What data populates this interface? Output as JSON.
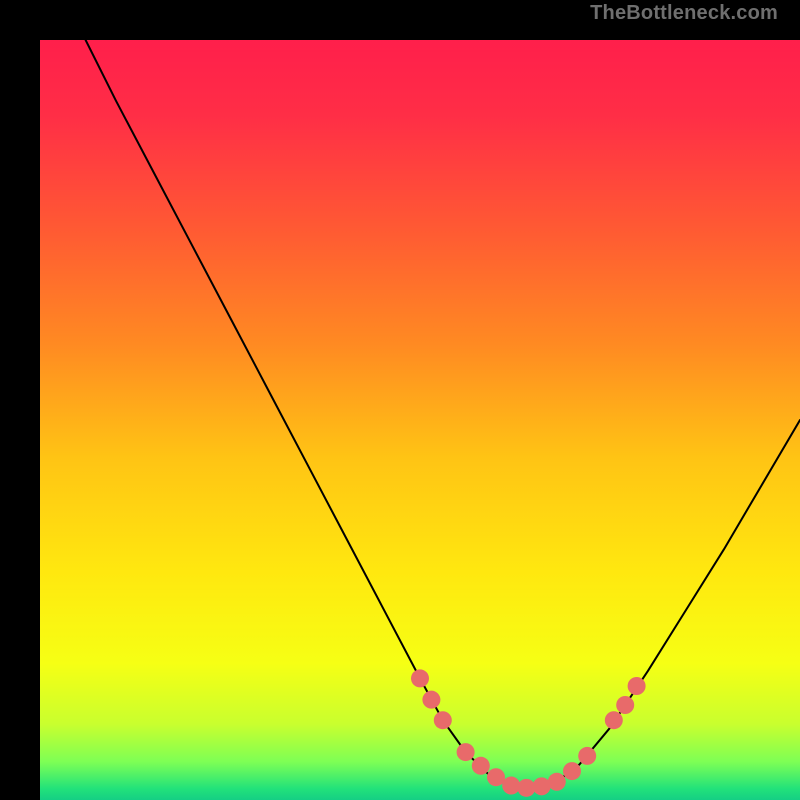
{
  "watermark": "TheBottleneck.com",
  "gradient_stops": [
    {
      "pos": 0.0,
      "color": "#ff1f4b"
    },
    {
      "pos": 0.1,
      "color": "#ff2e46"
    },
    {
      "pos": 0.25,
      "color": "#ff5a33"
    },
    {
      "pos": 0.4,
      "color": "#ff8a22"
    },
    {
      "pos": 0.55,
      "color": "#ffc414"
    },
    {
      "pos": 0.7,
      "color": "#ffe80f"
    },
    {
      "pos": 0.82,
      "color": "#f6ff14"
    },
    {
      "pos": 0.9,
      "color": "#c9ff2e"
    },
    {
      "pos": 0.95,
      "color": "#7dff55"
    },
    {
      "pos": 0.985,
      "color": "#22e27a"
    },
    {
      "pos": 1.0,
      "color": "#15cf84"
    }
  ],
  "chart_data": {
    "type": "line",
    "title": "",
    "xlabel": "",
    "ylabel": "",
    "xlim": [
      0,
      100
    ],
    "ylim": [
      0,
      100
    ],
    "series": [
      {
        "name": "bottleneck-curve",
        "x": [
          6,
          10,
          15,
          20,
          25,
          30,
          35,
          40,
          45,
          50,
          53,
          56,
          59,
          62,
          65,
          68,
          71,
          75,
          80,
          85,
          90,
          95,
          100
        ],
        "y": [
          100,
          92,
          82.5,
          73,
          63.5,
          54,
          44.5,
          35,
          25.5,
          16,
          10.5,
          6.3,
          3.4,
          1.9,
          1.6,
          2.4,
          4.7,
          9.5,
          17,
          25,
          33,
          41.5,
          50
        ]
      }
    ],
    "markers": {
      "name": "highlight-dots",
      "color": "#e86a6a",
      "radius_px": 9,
      "points": [
        {
          "x": 50,
          "y": 16.0
        },
        {
          "x": 51.5,
          "y": 13.2
        },
        {
          "x": 53,
          "y": 10.5
        },
        {
          "x": 56,
          "y": 6.3
        },
        {
          "x": 58,
          "y": 4.5
        },
        {
          "x": 60,
          "y": 3.0
        },
        {
          "x": 62,
          "y": 1.9
        },
        {
          "x": 64,
          "y": 1.6
        },
        {
          "x": 66,
          "y": 1.8
        },
        {
          "x": 68,
          "y": 2.4
        },
        {
          "x": 70,
          "y": 3.8
        },
        {
          "x": 72,
          "y": 5.8
        },
        {
          "x": 75.5,
          "y": 10.5
        },
        {
          "x": 77,
          "y": 12.5
        },
        {
          "x": 78.5,
          "y": 15.0
        }
      ]
    }
  }
}
